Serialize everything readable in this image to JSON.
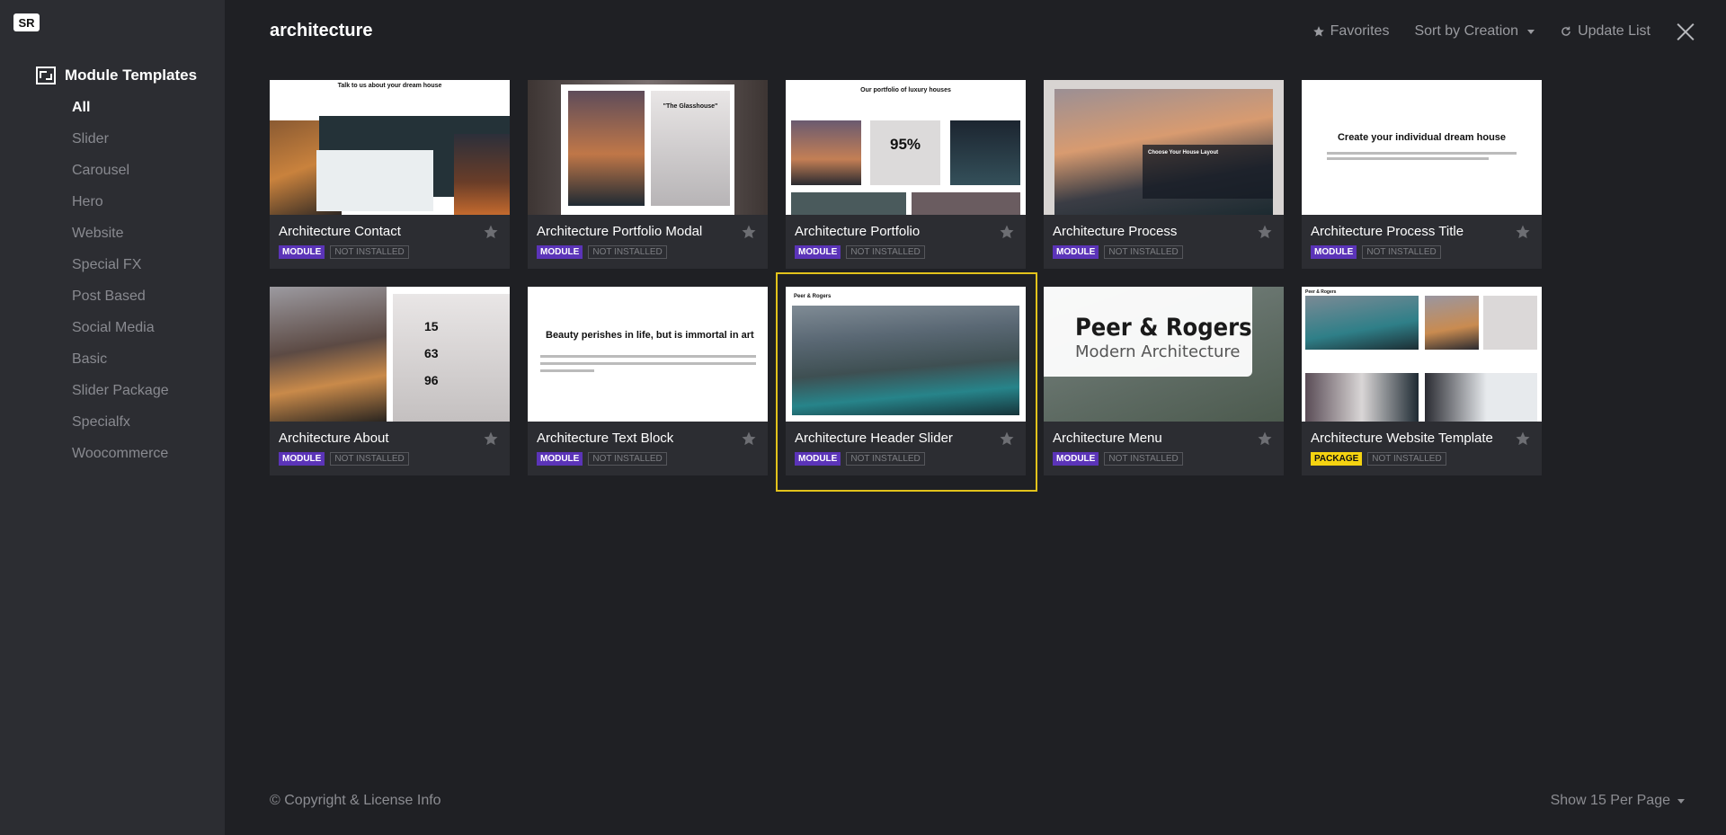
{
  "sidebar": {
    "logo": "SR",
    "header": "Module Templates",
    "items": [
      {
        "label": "All",
        "active": true
      },
      {
        "label": "Slider"
      },
      {
        "label": "Carousel"
      },
      {
        "label": "Hero"
      },
      {
        "label": "Website"
      },
      {
        "label": "Special FX"
      },
      {
        "label": "Post Based"
      },
      {
        "label": "Social Media"
      },
      {
        "label": "Basic"
      },
      {
        "label": "Slider Package"
      },
      {
        "label": "Specialfx"
      },
      {
        "label": "Woocommerce"
      }
    ]
  },
  "header": {
    "search_term": "architecture",
    "favorites": "Favorites",
    "sort": "Sort by Creation",
    "update": "Update List"
  },
  "cards": [
    {
      "title": "Architecture Contact",
      "type": "MODULE",
      "status": "NOT INSTALLED",
      "thumb_text": "Talk to us about your dream house"
    },
    {
      "title": "Architecture Portfolio Modal",
      "type": "MODULE",
      "status": "NOT INSTALLED",
      "thumb_text": "\"The Glasshouse\""
    },
    {
      "title": "Architecture Portfolio",
      "type": "MODULE",
      "status": "NOT INSTALLED",
      "thumb_text": "Our portfolio of luxury houses",
      "thumb_num": "95%"
    },
    {
      "title": "Architecture Process",
      "type": "MODULE",
      "status": "NOT INSTALLED",
      "thumb_text": "Choose Your House Layout"
    },
    {
      "title": "Architecture Process Title",
      "type": "MODULE",
      "status": "NOT INSTALLED",
      "thumb_text": "Create your individual dream house"
    },
    {
      "title": "Architecture About",
      "type": "MODULE",
      "status": "NOT INSTALLED",
      "thumb_nums": [
        "15",
        "63",
        "96"
      ]
    },
    {
      "title": "Architecture Text Block",
      "type": "MODULE",
      "status": "NOT INSTALLED",
      "thumb_text": "Beauty perishes in life, but is immortal in art"
    },
    {
      "title": "Architecture Header Slider",
      "type": "MODULE",
      "status": "NOT INSTALLED",
      "thumb_text": "Peer & Rogers"
    },
    {
      "title": "Architecture Menu",
      "type": "MODULE",
      "status": "NOT INSTALLED",
      "thumb_text": "Peer & Rogers",
      "thumb_sub": "Modern Architecture"
    },
    {
      "title": "Architecture Website Template",
      "type": "PACKAGE",
      "status": "NOT INSTALLED",
      "thumb_text": "Peer & Rogers"
    }
  ],
  "footer": {
    "copyright": "© Copyright & License Info",
    "per_page": "Show 15 Per Page"
  },
  "colors": {
    "module_badge": "#5b34b8",
    "package_badge": "#f5d311",
    "highlight": "#e2c21b"
  }
}
